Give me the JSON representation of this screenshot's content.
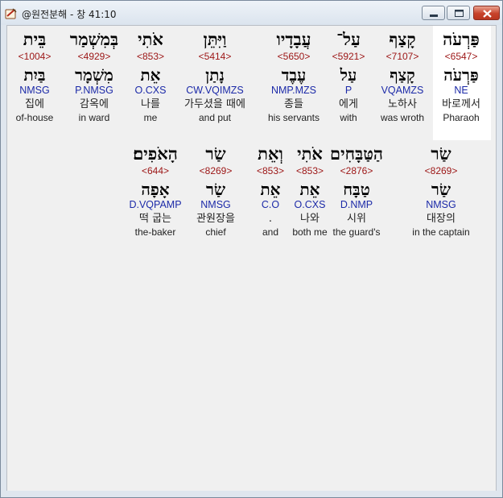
{
  "window": {
    "title": "@원전분해 - 창 41:10",
    "icon": "parchment-app-icon"
  },
  "colors": {
    "hebrew": "#000000",
    "strong": "#9c1515",
    "parse": "#1c2aa8",
    "gloss": "#222222",
    "highlight": "#ffffff"
  },
  "row1": [
    {
      "heb": "פַּרְעֹה",
      "strong": "<6547>",
      "lemma": "פַּרְעֹה",
      "parse": "NE",
      "ko": "바로께서",
      "en": "Pharaoh"
    },
    {
      "heb": "קָצַף",
      "strong": "<7107>",
      "lemma": "קָצַף",
      "parse": "VQAMZS",
      "ko": "노하사",
      "en": "was wroth"
    },
    {
      "heb": "עַל־",
      "strong": "<5921>",
      "lemma": "עַל",
      "parse": "P",
      "ko": "에게",
      "en": "with"
    },
    {
      "heb": "עֲבָדָיו",
      "strong": "<5650>",
      "lemma": "עֶבֶד",
      "parse": "NMP.MZS",
      "ko": "종들",
      "en": "his servants"
    },
    {
      "heb": "וַיִּתֵּן",
      "strong": "<5414>",
      "lemma": "נָתַן",
      "parse": "CW.VQIMZS",
      "ko": "가두셨을 때에",
      "en": "and put"
    },
    {
      "heb": "אֹתִי",
      "strong": "<853>",
      "lemma": "אֵת",
      "parse": "O.CXS",
      "ko": "나를",
      "en": "me"
    },
    {
      "heb": "בְּמִשְׁמַר",
      "strong": "<4929>",
      "lemma": "מִשְׁמָר",
      "parse": "P.NMSG",
      "ko": "감옥에",
      "en": "in ward"
    },
    {
      "heb": "בֵּית",
      "strong": "<1004>",
      "lemma": "בַּיִת",
      "parse": "NMSG",
      "ko": "집에",
      "en": "of-house"
    }
  ],
  "row2": [
    {
      "heb": "שַׂר",
      "strong": "<8269>",
      "lemma": "שַׂר",
      "parse": "NMSG",
      "ko": "대장의",
      "en": "in the captain"
    },
    {
      "heb": "הַטַּבָּחִים",
      "strong": "<2876>",
      "lemma": "טַבָּח",
      "parse": "D.NMP",
      "ko": "시위",
      "en": "the guard's"
    },
    {
      "heb": "אֹתִי",
      "strong": "<853>",
      "lemma": "אֵת",
      "parse": "O.CXS",
      "ko": "나와",
      "en": "both me"
    },
    {
      "heb": "וְאֵת",
      "strong": "<853>",
      "lemma": "אֵת",
      "parse": "C.O",
      "ko": ".",
      "en": "and"
    },
    {
      "heb": "שַׂר",
      "strong": "<8269>",
      "lemma": "שַׂר",
      "parse": "NMSG",
      "ko": "관원장을",
      "en": "chief"
    },
    {
      "heb": "הָאֹפִים׃",
      "strong": "<644>",
      "lemma": "אָפָה",
      "parse": "D.VQPAMP",
      "ko": "떡 굽는",
      "en": "the-baker"
    }
  ]
}
